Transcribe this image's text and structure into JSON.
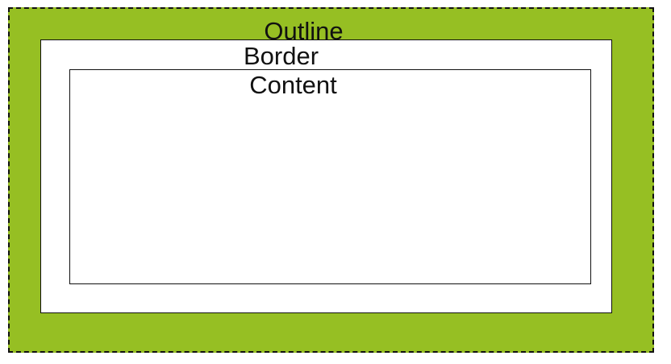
{
  "diagram": {
    "layers": [
      {
        "id": "outline",
        "label": "Outline",
        "fill": "#96bf23",
        "stroke": "#111111",
        "stroke_style": "dashed"
      },
      {
        "id": "border",
        "label": "Border",
        "fill": "#ffffff",
        "stroke": "#111111",
        "stroke_style": "solid"
      },
      {
        "id": "content",
        "label": "Content",
        "fill": "#ffffff",
        "stroke": "#111111",
        "stroke_style": "solid"
      }
    ]
  }
}
